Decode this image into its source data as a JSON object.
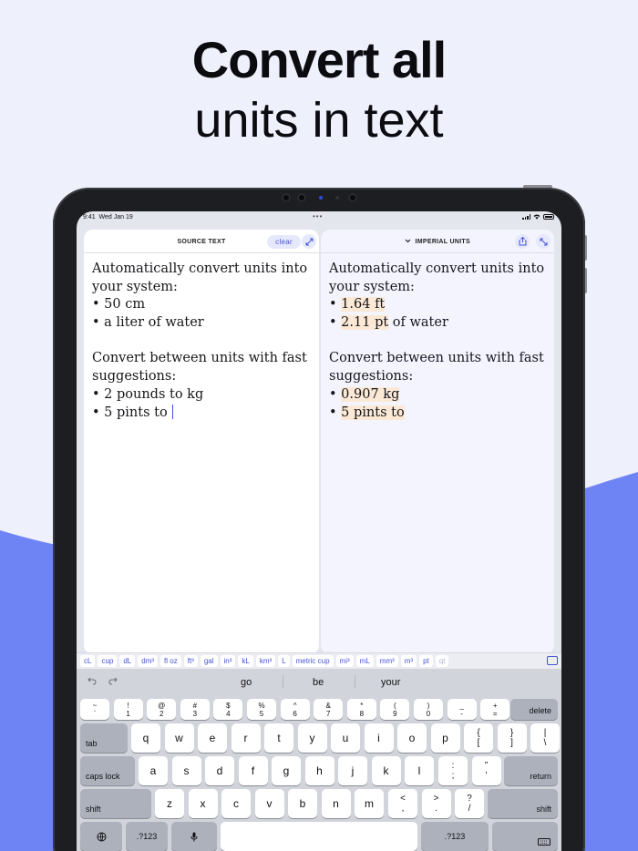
{
  "headline": {
    "line1": "Convert all",
    "line2": "units in text"
  },
  "status": {
    "time": "9:41",
    "date": "Wed Jan 19"
  },
  "left_panel": {
    "title": "SOURCE TEXT",
    "clear_label": "clear",
    "lines": [
      [
        {
          "t": "Automatically convert units into"
        }
      ],
      [
        {
          "t": "your system:"
        }
      ],
      [
        {
          "t": "• 50 cm"
        }
      ],
      [
        {
          "t": "• a liter of water"
        }
      ],
      [
        {
          "t": ""
        }
      ],
      [
        {
          "t": "Convert between units with fast"
        }
      ],
      [
        {
          "t": "suggestions:"
        }
      ],
      [
        {
          "t": "• 2 pounds to kg"
        }
      ],
      [
        {
          "t": "• 5 pints to "
        }
      ]
    ]
  },
  "right_panel": {
    "title": "IMPERIAL UNITS",
    "lines": [
      [
        {
          "t": "Automatically convert units into"
        }
      ],
      [
        {
          "t": "your system:"
        }
      ],
      [
        {
          "t": "• "
        },
        {
          "t": "1.64 ft",
          "hl": true
        }
      ],
      [
        {
          "t": "• "
        },
        {
          "t": "2.11 pt",
          "hl": true
        },
        {
          "t": " of water"
        }
      ],
      [
        {
          "t": ""
        }
      ],
      [
        {
          "t": "Convert between units with fast"
        }
      ],
      [
        {
          "t": "suggestions:"
        }
      ],
      [
        {
          "t": "• "
        },
        {
          "t": "0.907 kg",
          "hl": true
        }
      ],
      [
        {
          "t": "• "
        },
        {
          "t": "5 pints to",
          "hl": true
        }
      ]
    ]
  },
  "unit_chips": [
    "cL",
    "cup",
    "dL",
    "dm³",
    "fl oz",
    "ft³",
    "gal",
    "in³",
    "kL",
    "km³",
    "L",
    "metric cup",
    "mi³",
    "mL",
    "mm³",
    "m³",
    "pt",
    "qt"
  ],
  "keyboard": {
    "suggestions": [
      "go",
      "be",
      "your"
    ],
    "num_row": [
      [
        "~",
        "`"
      ],
      [
        "!",
        "1"
      ],
      [
        "@",
        "2"
      ],
      [
        "#",
        "3"
      ],
      [
        "$",
        "4"
      ],
      [
        "%",
        "5"
      ],
      [
        "^",
        "6"
      ],
      [
        "&",
        "7"
      ],
      [
        "*",
        "8"
      ],
      [
        "(",
        "9"
      ],
      [
        ")",
        "0"
      ],
      [
        "_",
        "-"
      ],
      [
        "+",
        "="
      ]
    ],
    "delete_label": "delete",
    "tab_label": "tab",
    "row1": [
      "q",
      "w",
      "e",
      "r",
      "t",
      "y",
      "u",
      "i",
      "o",
      "p"
    ],
    "row1_extra": [
      [
        "{",
        "["
      ],
      [
        "}",
        "]"
      ],
      [
        "|",
        "\\"
      ]
    ],
    "caps_label": "caps lock",
    "row2": [
      "a",
      "s",
      "d",
      "f",
      "g",
      "h",
      "j",
      "k",
      "l"
    ],
    "row2_extra": [
      [
        ":",
        ";"
      ],
      [
        "”",
        "’"
      ]
    ],
    "return_label": "return",
    "shift_label": "shift",
    "row3": [
      "z",
      "x",
      "c",
      "v",
      "b",
      "n",
      "m"
    ],
    "row3_extra": [
      [
        "<",
        ","
      ],
      [
        ">",
        "."
      ],
      [
        "?",
        "/"
      ]
    ],
    "numkey_label": ".?123"
  },
  "colors": {
    "accent": "#4753d8",
    "highlight": "#fbe9d6",
    "background": "#eef0fc",
    "wave": "#6f84f4"
  }
}
